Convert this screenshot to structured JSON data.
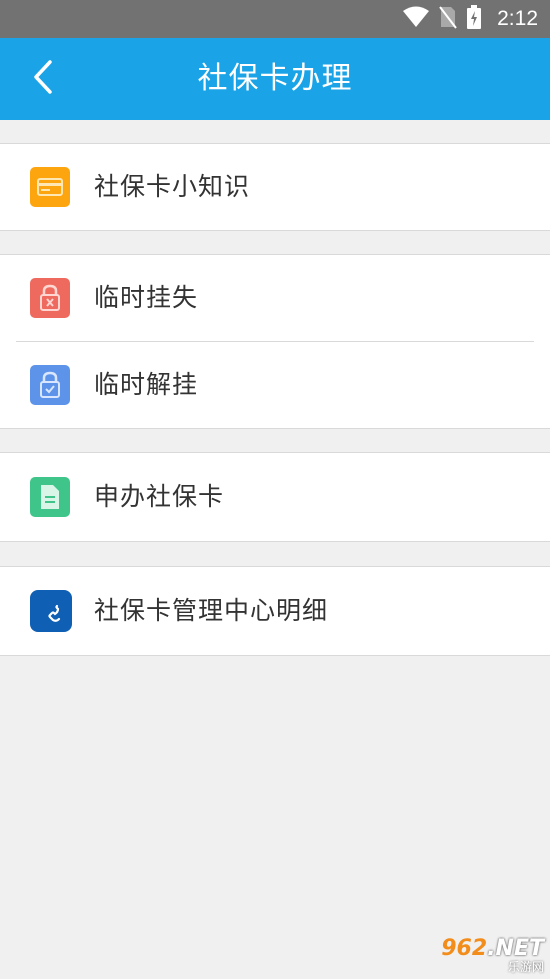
{
  "status_bar": {
    "time": "2:12"
  },
  "header": {
    "title": "社保卡办理"
  },
  "groups": [
    {
      "items": [
        {
          "label": "社保卡小知识",
          "icon": "card-icon",
          "color": "#fda50f"
        }
      ]
    },
    {
      "items": [
        {
          "label": "临时挂失",
          "icon": "lock-x-icon",
          "color": "#ef6a5e"
        },
        {
          "label": "临时解挂",
          "icon": "lock-check-icon",
          "color": "#5d93e8"
        }
      ]
    },
    {
      "items": [
        {
          "label": "申办社保卡",
          "icon": "document-icon",
          "color": "#3fc58a"
        }
      ]
    },
    {
      "items": [
        {
          "label": "社保卡管理中心明细",
          "icon": "phone-icon",
          "color": "#0f5fb4"
        }
      ]
    }
  ],
  "watermark": {
    "brand": "962",
    "suffix": ".NET",
    "sub": "乐游网"
  }
}
